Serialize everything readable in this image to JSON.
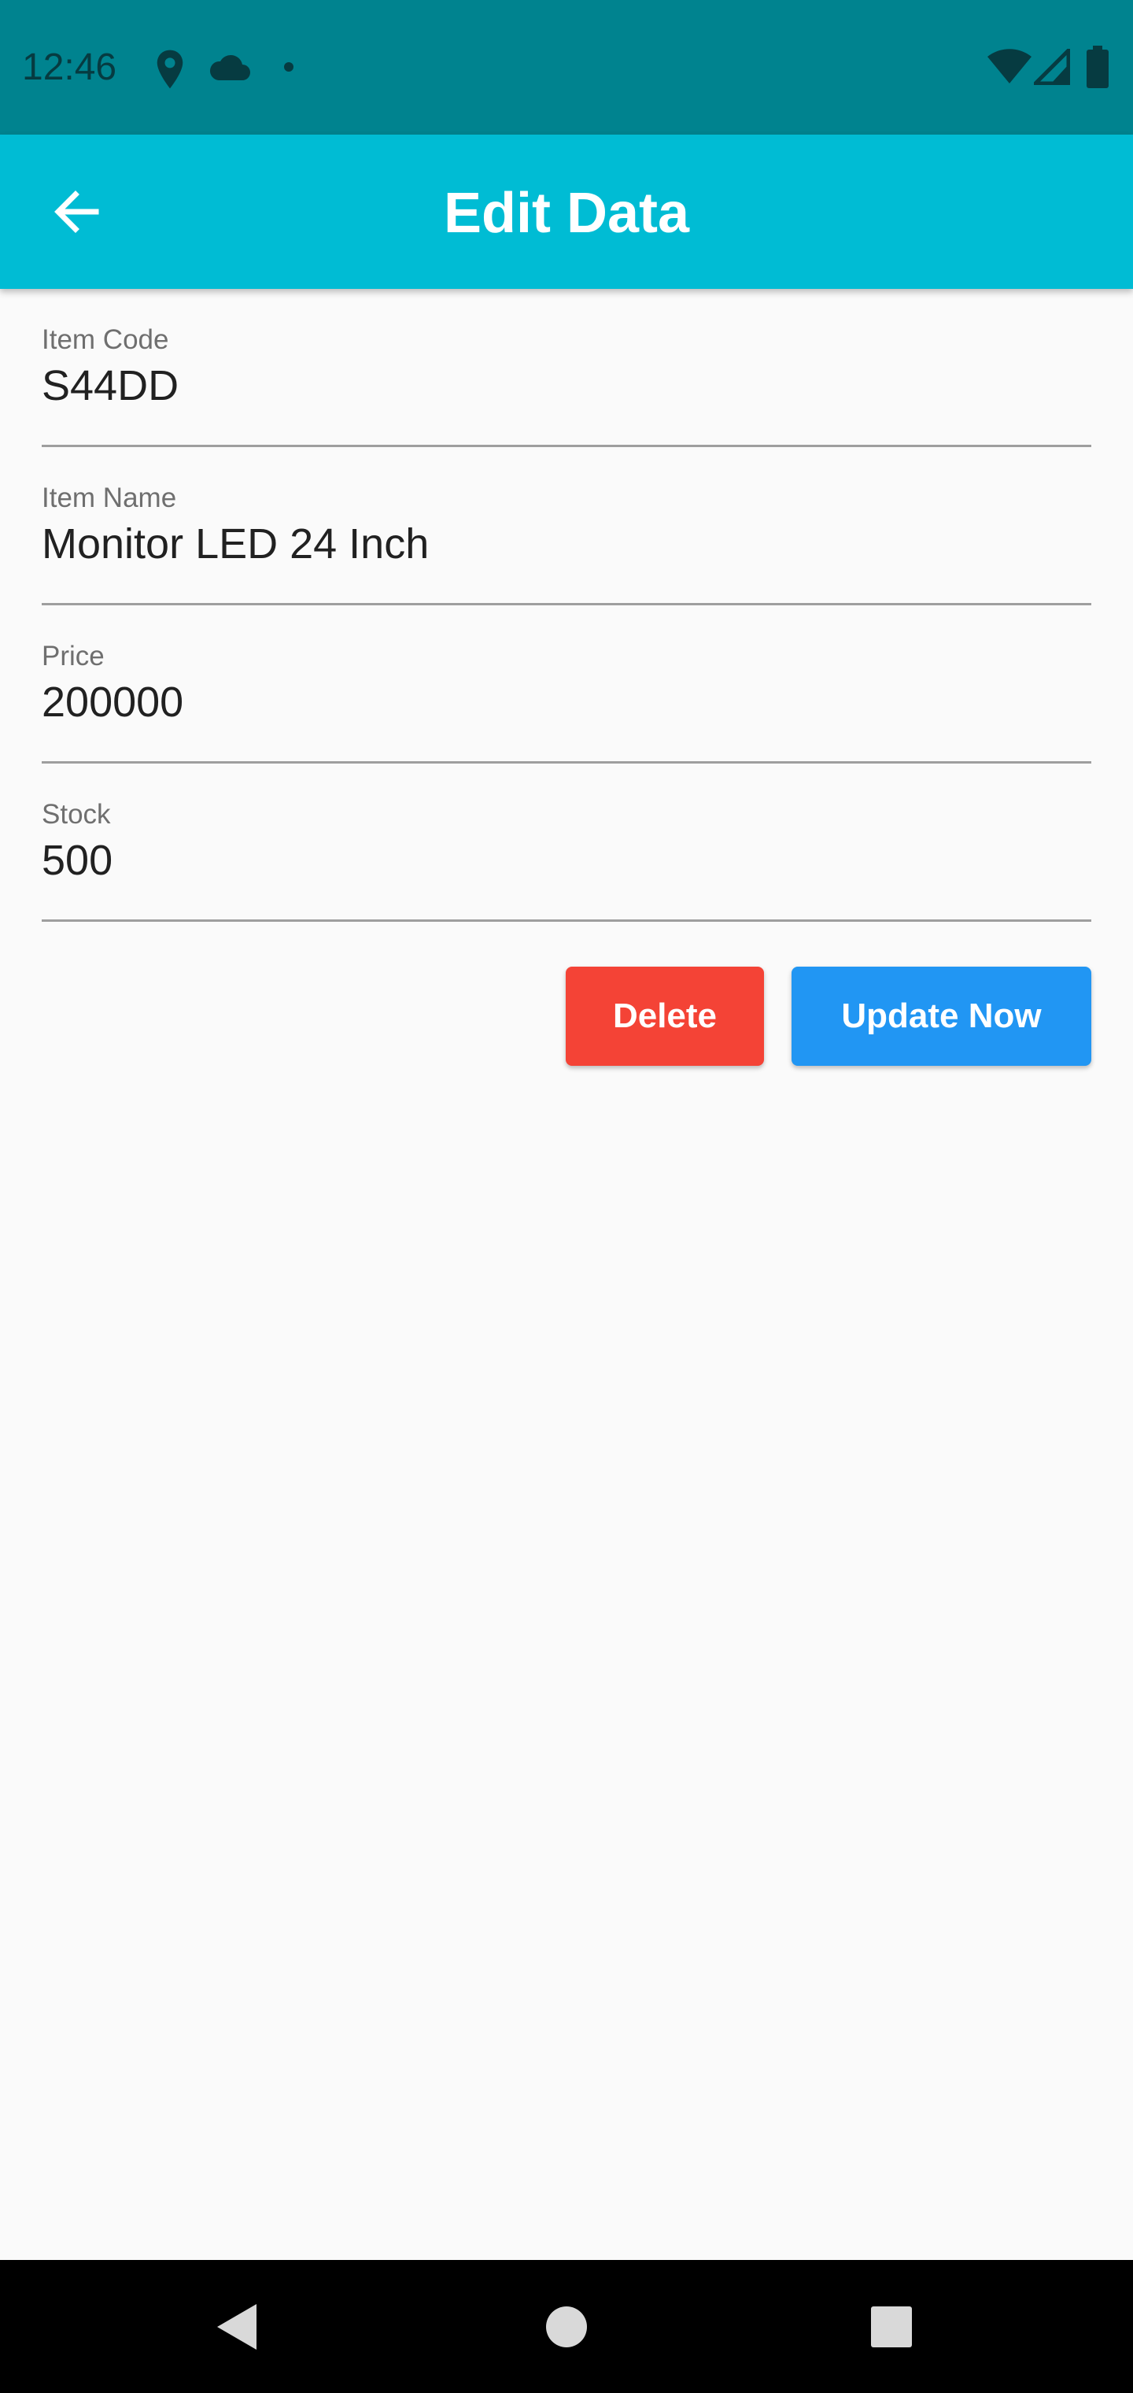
{
  "status_bar": {
    "time": "12:46",
    "left_icons": [
      "location-icon",
      "cloud-icon",
      "notification-dot-icon"
    ],
    "right_icons": [
      "wifi-icon",
      "signal-icon",
      "battery-icon"
    ]
  },
  "app_bar": {
    "title": "Edit Data",
    "back_icon": "arrow-back-icon",
    "color": "#00bcd4"
  },
  "form": {
    "fields": [
      {
        "label": "Item Code",
        "value": "S44DD"
      },
      {
        "label": "Item Name",
        "value": "Monitor LED 24 Inch"
      },
      {
        "label": "Price",
        "value": "200000"
      },
      {
        "label": "Stock",
        "value": "500"
      }
    ]
  },
  "actions": {
    "delete_label": "Delete",
    "delete_color": "#f44336",
    "update_label": "Update Now",
    "update_color": "#2196f3"
  },
  "nav_bar": {
    "icons": [
      "back-triangle-icon",
      "home-circle-icon",
      "recents-square-icon"
    ]
  }
}
